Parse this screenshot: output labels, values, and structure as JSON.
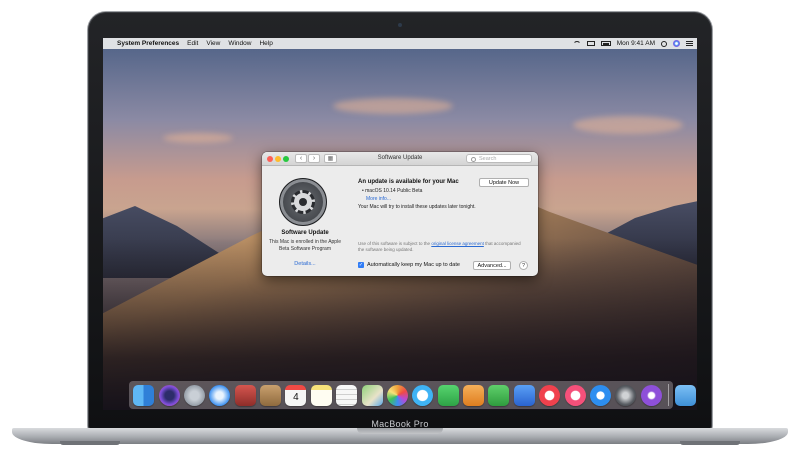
{
  "device": {
    "model_label": "MacBook Pro"
  },
  "menubar": {
    "items": [
      "System Preferences",
      "Edit",
      "View",
      "Window",
      "Help"
    ],
    "clock": "Mon 9:41 AM"
  },
  "window": {
    "title": "Software Update",
    "search_placeholder": "Search",
    "sidebar": {
      "title": "Software Update",
      "description": "This Mac is enrolled in the Apple Beta Software Program",
      "details_link": "Details..."
    },
    "main": {
      "heading": "An update is available for your Mac",
      "update_item": "• macOS 10.14 Public Beta",
      "more_info": "More info...",
      "note": "Your Mac will try to install these updates later tonight.",
      "update_button": "Update Now",
      "license_prefix": "Use of this software is subject to the",
      "license_link": "original license agreement",
      "license_suffix": "that accompanied the software being updated.",
      "auto_update_label": "Automatically keep my Mac up to date",
      "auto_update_checked": true,
      "advanced_button": "Advanced...",
      "help_button": "?"
    }
  },
  "dock": {
    "apps": [
      {
        "name": "finder-icon",
        "color": "#4aa3f0"
      },
      {
        "name": "siri-icon",
        "color": "#7b4fd8"
      },
      {
        "name": "launchpad-icon",
        "color": "#9aa3ad"
      },
      {
        "name": "safari-icon",
        "color": "#3b8ff0"
      },
      {
        "name": "photo-booth-icon",
        "color": "#c94a4a"
      },
      {
        "name": "contacts-icon",
        "color": "#b98a55"
      },
      {
        "name": "calendar-icon",
        "color": "#f5f5f5"
      },
      {
        "name": "notes-icon",
        "color": "#f7e27a"
      },
      {
        "name": "reminders-icon",
        "color": "#f2f2f2"
      },
      {
        "name": "maps-icon",
        "color": "#7cc46a"
      },
      {
        "name": "photos-icon",
        "color": "#f0a23c"
      },
      {
        "name": "messages-icon",
        "color": "#3fb3f5"
      },
      {
        "name": "facetime-icon",
        "color": "#3ec25b"
      },
      {
        "name": "pages-icon",
        "color": "#f29b3d"
      },
      {
        "name": "numbers-icon",
        "color": "#40b84f"
      },
      {
        "name": "keynote-icon",
        "color": "#3a7df0"
      },
      {
        "name": "news-icon",
        "color": "#f0414d"
      },
      {
        "name": "music-icon",
        "color": "#f5507a"
      },
      {
        "name": "app-store-icon",
        "color": "#2d8ef0"
      },
      {
        "name": "system-preferences-icon",
        "color": "#7b7f86"
      },
      {
        "name": "feedback-assistant-icon",
        "color": "#8e50d9"
      }
    ],
    "folders": [
      {
        "name": "downloads-folder-icon",
        "color": "#5aa8e8"
      },
      {
        "name": "trash-icon",
        "color": "#d9dde2"
      }
    ],
    "calendar_day": "4"
  }
}
